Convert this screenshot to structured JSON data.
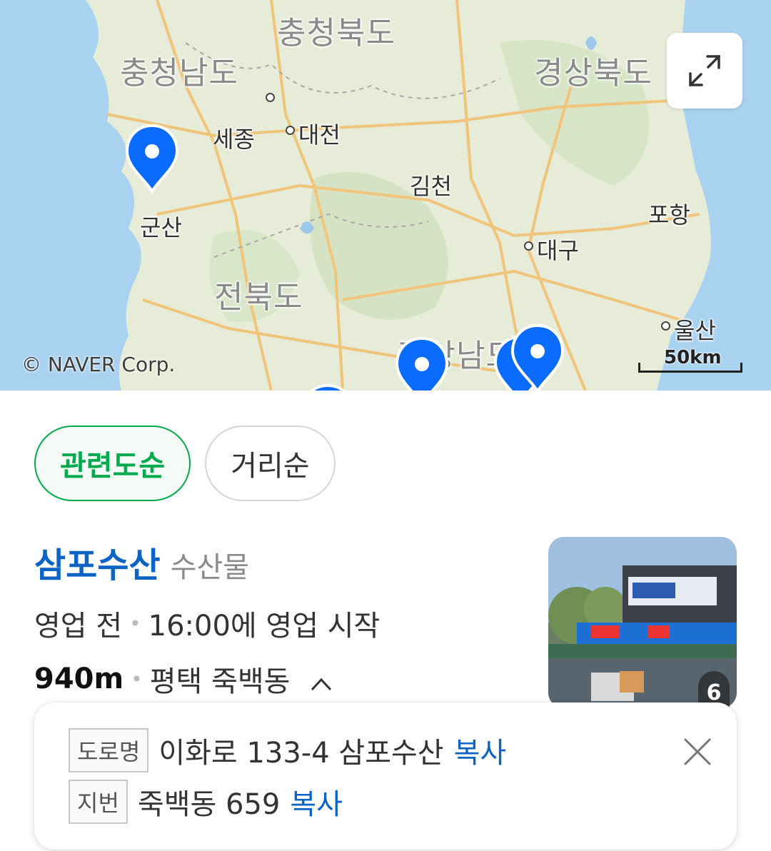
{
  "map": {
    "province_labels": [
      "충청북도",
      "충청남도",
      "경상북도",
      "전북도",
      "경상남도"
    ],
    "city_labels": [
      "세종",
      "대전",
      "김천",
      "군산",
      "포항",
      "대구",
      "울산"
    ],
    "copyright": "© NAVER Corp.",
    "scale": "50km",
    "expand_icon": "expand-arrows-icon",
    "pin_color": "#0a6cff"
  },
  "sort_chips": [
    {
      "label": "관련도순",
      "active": true
    },
    {
      "label": "거리순",
      "active": false
    }
  ],
  "result": {
    "name": "삼포수산",
    "category": "수산물",
    "status": "영업 전",
    "open_time": "16:00에 영업 시작",
    "distance": "940m",
    "area": "평택 죽백동",
    "area_toggle_icon": "chevron-up-icon",
    "photo_count": "6"
  },
  "address_popup": {
    "road_tag": "도로명",
    "road_address": "이화로 133-4 삼포수산",
    "lot_tag": "지번",
    "lot_address": "죽백동 659",
    "copy_label": "복사",
    "close_icon": "close-icon"
  },
  "colors": {
    "accent_green": "#03a94d",
    "link_blue": "#0b63c4",
    "sea": "#a9d2f0"
  }
}
